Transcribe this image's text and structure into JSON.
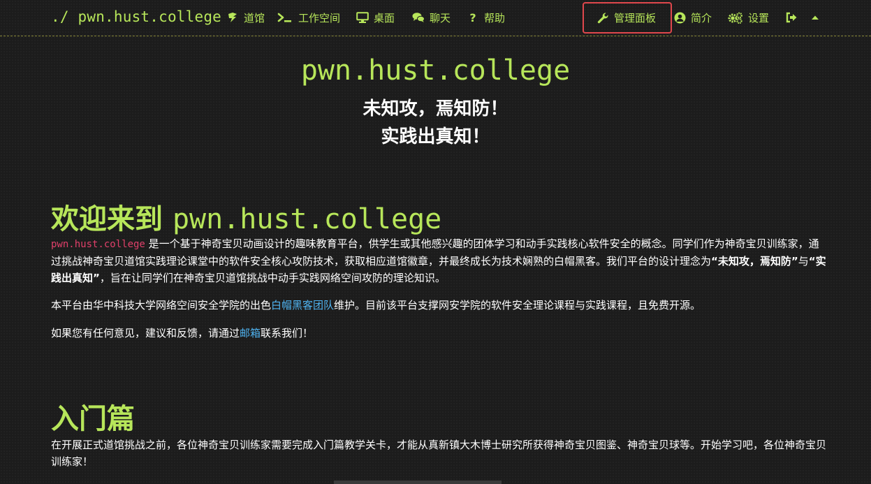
{
  "navbar": {
    "brand": "./ pwn.hust.college",
    "left_items": [
      {
        "label": "道馆",
        "icon": "dojo-icon"
      },
      {
        "label": "工作空间",
        "icon": "terminal-icon"
      },
      {
        "label": "桌面",
        "icon": "desktop-icon"
      },
      {
        "label": "聊天",
        "icon": "chat-icon"
      },
      {
        "label": "帮助",
        "icon": "help-icon"
      }
    ],
    "right_items": [
      {
        "label": "管理面板",
        "icon": "wrench-icon"
      },
      {
        "label": "简介",
        "icon": "user-icon"
      },
      {
        "label": "设置",
        "icon": "cogs-icon"
      }
    ],
    "logout_icon": "logout-icon",
    "toggle_icon": "caret-up-icon",
    "colors": {
      "accent": "#b7e65a",
      "highlight_border": "#e0474c"
    }
  },
  "hero": {
    "title": "pwn.hust.college",
    "line1": "未知攻，焉知防！",
    "line2": "实践出真知！"
  },
  "welcome": {
    "title_prefix": "欢迎来到 ",
    "title_site": "pwn.hust.college",
    "p1_code": "pwn.hust.college",
    "p1_text1": " 是一个基于神奇宝贝动画设计的趣味教育平台，供学生或其他感兴趣的团体学习和动手实践核心软件安全的概念。同学们作为神奇宝贝训练家，通过挑战神奇宝贝道馆实践理论课堂中的软件安全核心攻防技术，获取相应道馆徽章，并最终成长为技术娴熟的白帽黑客。我们平台的设计理念为",
    "p1_bold1": "“未知攻，焉知防”",
    "p1_text2": "与",
    "p1_bold2": "“实践出真知”",
    "p1_text3": "，旨在让同学们在神奇宝贝道馆挑战中动手实践网络空间攻防的理论知识。",
    "p2_text1": "本平台由华中科技大学网络空间安全学院的出色",
    "p2_link": "白帽黑客团队",
    "p2_text2": "维护。目前该平台支撑网安学院的软件安全理论课程与实践课程，且免费开源。",
    "p3_text1": "如果您有任何意见，建议和反馈，请通过",
    "p3_link": "邮箱",
    "p3_text2": "联系我们！",
    "colors": {
      "code": "#e0406a",
      "link": "#4fb3f0"
    }
  },
  "intro": {
    "title": "入门篇",
    "p1": "在开展正式道馆挑战之前，各位神奇宝贝训练家需要完成入门篇教学关卡，才能从真新镇大木博士研究所获得神奇宝贝图鉴、神奇宝贝球等。开始学习吧，各位神奇宝贝训练家！"
  }
}
